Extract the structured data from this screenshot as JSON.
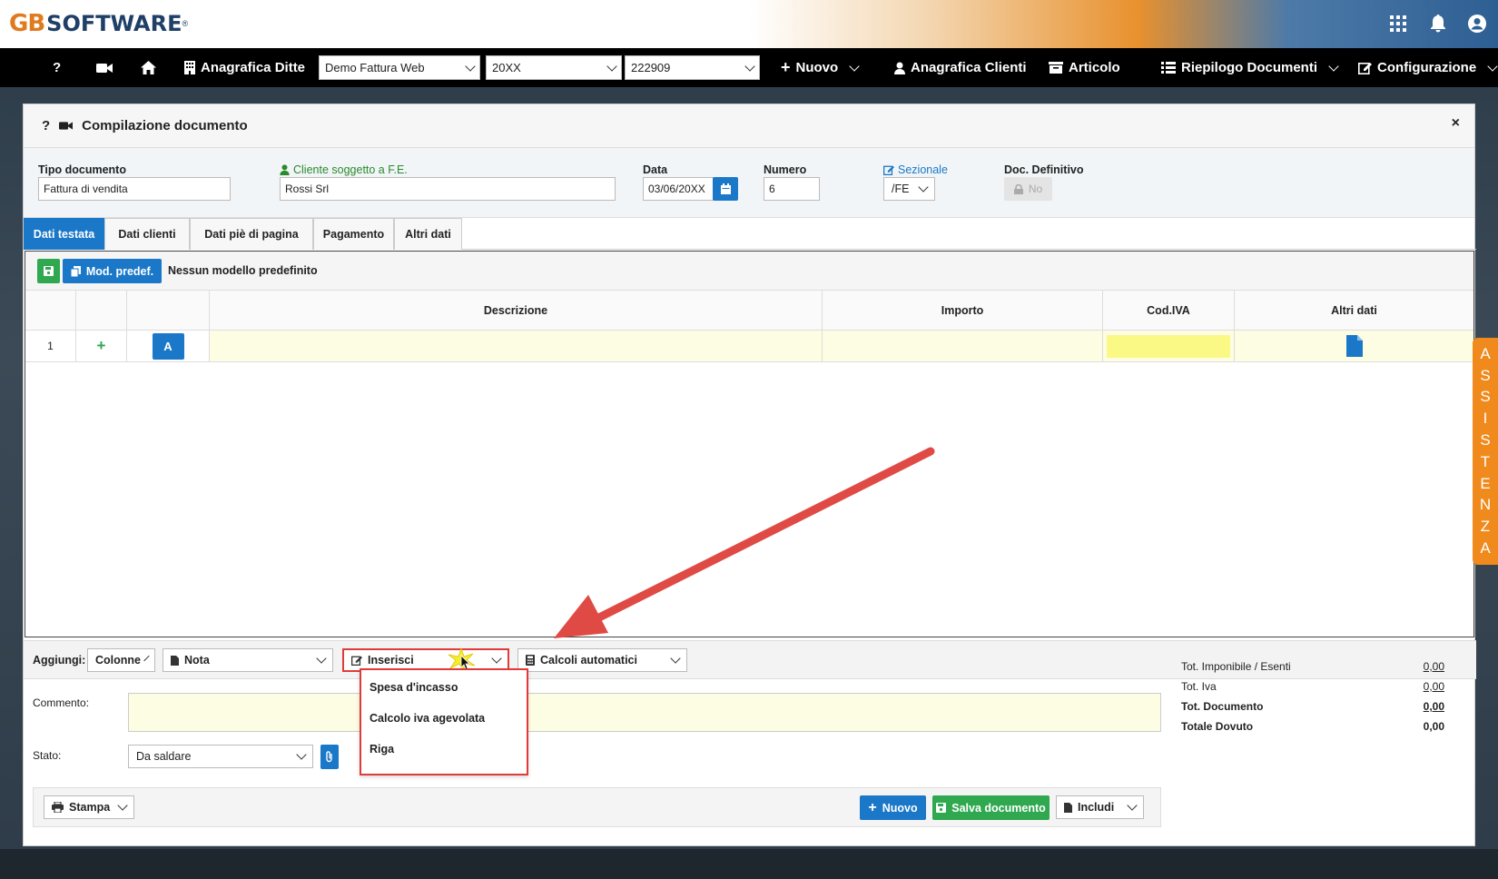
{
  "header": {
    "logo_gb": "GB",
    "logo_text": "SOFTWARE",
    "logo_reg": "®"
  },
  "navbar": {
    "help": "?",
    "anagrafica_ditte": "Anagrafica Ditte",
    "company_select": "Demo Fattura Web",
    "year_select": "20XX",
    "code_select": "222909",
    "nuovo": "Nuovo",
    "anagrafica_clienti": "Anagrafica Clienti",
    "articolo": "Articolo",
    "riepilogo": "Riepilogo Documenti",
    "configurazione": "Configurazione"
  },
  "panel": {
    "help": "?",
    "title": "Compilazione documento",
    "close": "×"
  },
  "fields": {
    "tipo_label": "Tipo documento",
    "tipo_value": "Fattura di vendita",
    "cliente_label": "Cliente soggetto a F.E.",
    "cliente_value": "Rossi Srl",
    "data_label": "Data",
    "data_value": "03/06/20XX",
    "numero_label": "Numero",
    "numero_value": "6",
    "sezionale_label": "Sezionale",
    "sezionale_value": "/FE",
    "definitivo_label": "Doc. Definitivo",
    "definitivo_value": "No"
  },
  "tabs": [
    "Dati testata",
    "Dati clienti",
    "Dati piè di pagina",
    "Pagamento",
    "Altri dati"
  ],
  "toolbar": {
    "mod_predef": "Mod. predef.",
    "modello": "Nessun modello predefinito"
  },
  "grid": {
    "headers": [
      "",
      "",
      "",
      "Descrizione",
      "Importo",
      "Cod.IVA",
      "Altri dati"
    ],
    "row": {
      "num": "1",
      "add": "+",
      "type": "A"
    }
  },
  "addrow": {
    "label": "Aggiungi:",
    "colonne": "Colonne",
    "nota": "Nota",
    "inserisci": "Inserisci",
    "calcoli": "Calcoli automatici"
  },
  "menu": [
    "Spesa d'incasso",
    "Calcolo iva agevolata",
    "Riga"
  ],
  "bottom": {
    "commento_label": "Commento:",
    "stato_label": "Stato:",
    "stato_value": "Da saldare"
  },
  "totals": [
    {
      "label": "Tot. Imponibile / Esenti",
      "value": "0,00"
    },
    {
      "label": "Tot. Iva",
      "value": "0,00"
    },
    {
      "label": "Tot. Documento",
      "value": "0,00"
    },
    {
      "label": "Totale Dovuto",
      "value": "0,00"
    }
  ],
  "actions": {
    "stampa": "Stampa",
    "nuovo": "Nuovo",
    "salva": "Salva documento",
    "includi": "Includi"
  },
  "assistenza": [
    "A",
    "S",
    "S",
    "I",
    "S",
    "T",
    "E",
    "N",
    "Z",
    "A"
  ],
  "colors": {
    "accent_blue": "#1b78c9",
    "green": "#2fa84f",
    "orange": "#f08a1c",
    "highlight_red": "#e03b3b"
  }
}
